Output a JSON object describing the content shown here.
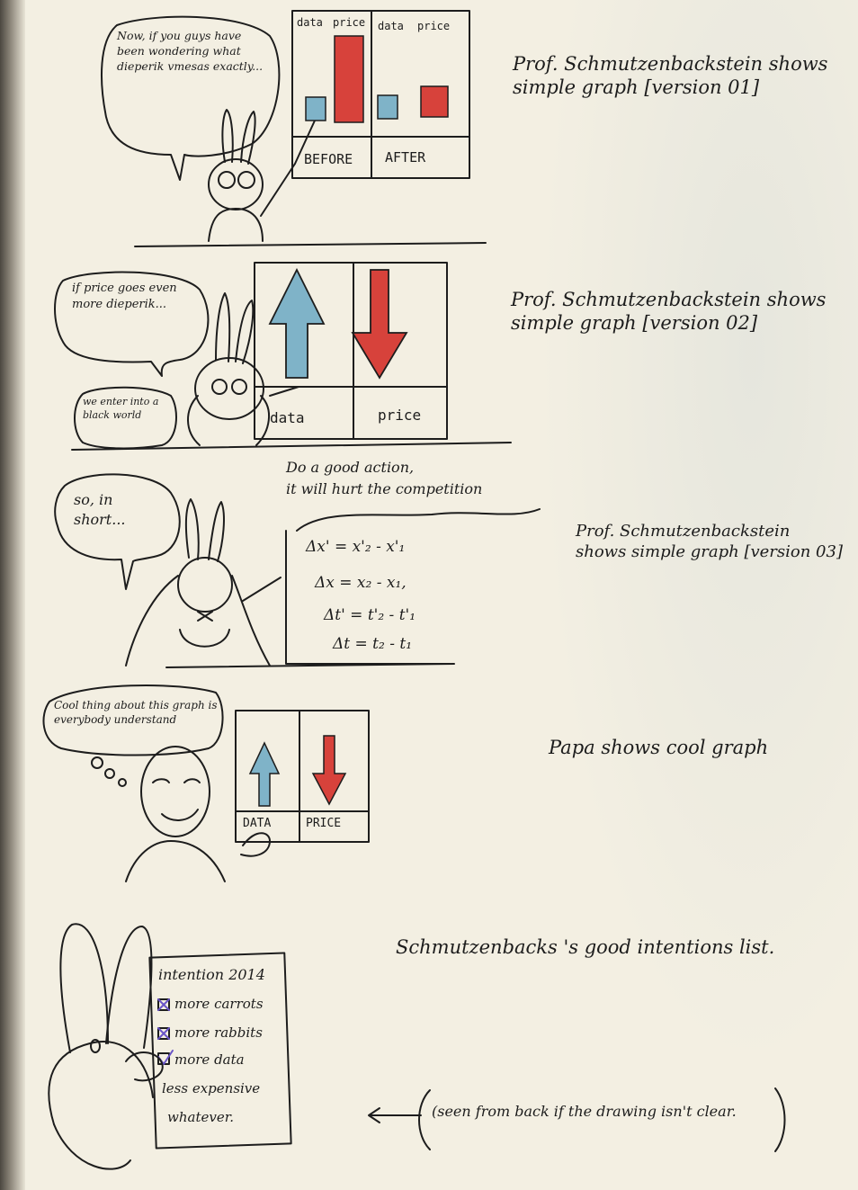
{
  "panel1": {
    "speech": "Now, if you guys have been wondering what dieperik vmesas exactly...",
    "chart_labels": [
      "data",
      "price",
      "data",
      "price"
    ],
    "axis_before": "BEFORE",
    "axis_after": "AFTER",
    "note": "Prof. Schmutzenbackstein shows simple graph [version 01]"
  },
  "panel2": {
    "speech": "if price goes even more dieperik...",
    "speech2": "we enter into a black world",
    "label_data": "data",
    "label_price": "price",
    "note": "Prof. Schmutzenbackstein shows simple graph [version 02]"
  },
  "panel3": {
    "speech": "so, in short...",
    "header_line1": "Do a good action,",
    "header_line2": "it will hurt the competition",
    "formulas": [
      "Δx' = x'₂ - x'₁",
      "Δx = x₂ - x₁,",
      "Δt' = t'₂ - t'₁",
      "Δt = t₂ - t₁"
    ],
    "note": "Prof. Schmutzenbackstein shows simple graph [version 03]"
  },
  "panel4": {
    "thought": "Cool thing about this graph is everybody understand",
    "label_data": "DATA",
    "label_price": "PRICE",
    "note": "Papa shows cool graph"
  },
  "panel5": {
    "list_title": "intention 2014",
    "items": [
      "more carrots",
      "more rabbits",
      "more data",
      "less expensive",
      "whatever."
    ],
    "note": "Schmutzenbacks 's good intentions list.",
    "aside": "(seen from back if the drawing isn't clear."
  },
  "colors": {
    "blue": "#7fb3c8",
    "red": "#d7423b",
    "ink": "#1d1d1d"
  }
}
